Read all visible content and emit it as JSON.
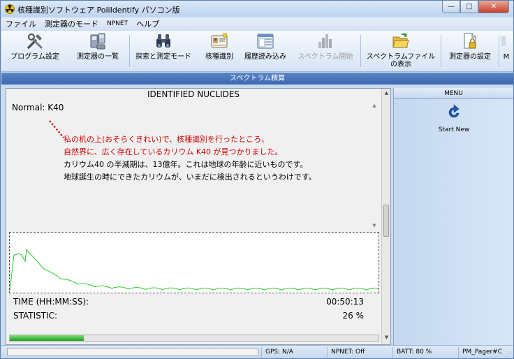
{
  "window": {
    "title": "核種識別ソフトウェア PoliIdentify パソコン版",
    "controls": {
      "minimize": "—",
      "maximize": "□",
      "close": "✕"
    }
  },
  "menubar": {
    "items": [
      "ファイル",
      "測定器のモード",
      "NPNET",
      "ヘルプ"
    ]
  },
  "toolbar": {
    "buttons": [
      {
        "label": "プログラム設定",
        "icon": "tools-icon",
        "enabled": true
      },
      {
        "label": "測定器の一覧",
        "icon": "devices-icon",
        "enabled": true
      },
      {
        "label": "探索と測定モード",
        "icon": "binoculars-icon",
        "enabled": true
      },
      {
        "label": "核種識別",
        "icon": "id-card-icon",
        "enabled": true
      },
      {
        "label": "履歴読み込み",
        "icon": "history-window-icon",
        "enabled": true
      },
      {
        "label": "スペクトラム開始",
        "icon": "bar-chart-icon",
        "enabled": false
      },
      {
        "label": "スペクトラムファイル",
        "label2": "の表示",
        "icon": "folder-icon",
        "enabled": true
      },
      {
        "label": "測定器の設定",
        "icon": "locked-doc-icon",
        "enabled": true
      },
      {
        "label": "M",
        "icon": "more-icon",
        "enabled": true
      }
    ]
  },
  "section_header": "スペクトラム積算",
  "main": {
    "title": "IDENTIFIED NUCLIDES",
    "nuclide_line": "Normal: K40",
    "comment_lines": [
      {
        "text": "私の机の上(おそらくきれい)で、核種識別を行ったところ、",
        "color": "red"
      },
      {
        "text": "自然界に、広く存在しているカリウム K40 が見つかりました。",
        "color": "red"
      },
      {
        "text": "カリウム40 の半減期は、13億年。これは地球の年齢に近いものです。",
        "color": "black"
      },
      {
        "text": "地球誕生の時にできたカリウムが、いまだに検出されるというわけです。",
        "color": "black"
      }
    ],
    "time_label": "TIME (HH:MM:SS):",
    "time_value": "00:50:13",
    "statistic_label": "STATISTIC:",
    "statistic_value": "26 %",
    "progress_fraction": 0.2
  },
  "side": {
    "header": "MENU",
    "start_new": "Start New"
  },
  "statusbar": {
    "gps": "GPS: N/A",
    "npnet": "NPNET: Off",
    "batt": "BATT: 80 %",
    "pager": "PM_Pager#C"
  },
  "colors": {
    "spectrum_line": "#22cc22",
    "annotation_red": "#d40000",
    "header_blue": "#3a68b0"
  }
}
